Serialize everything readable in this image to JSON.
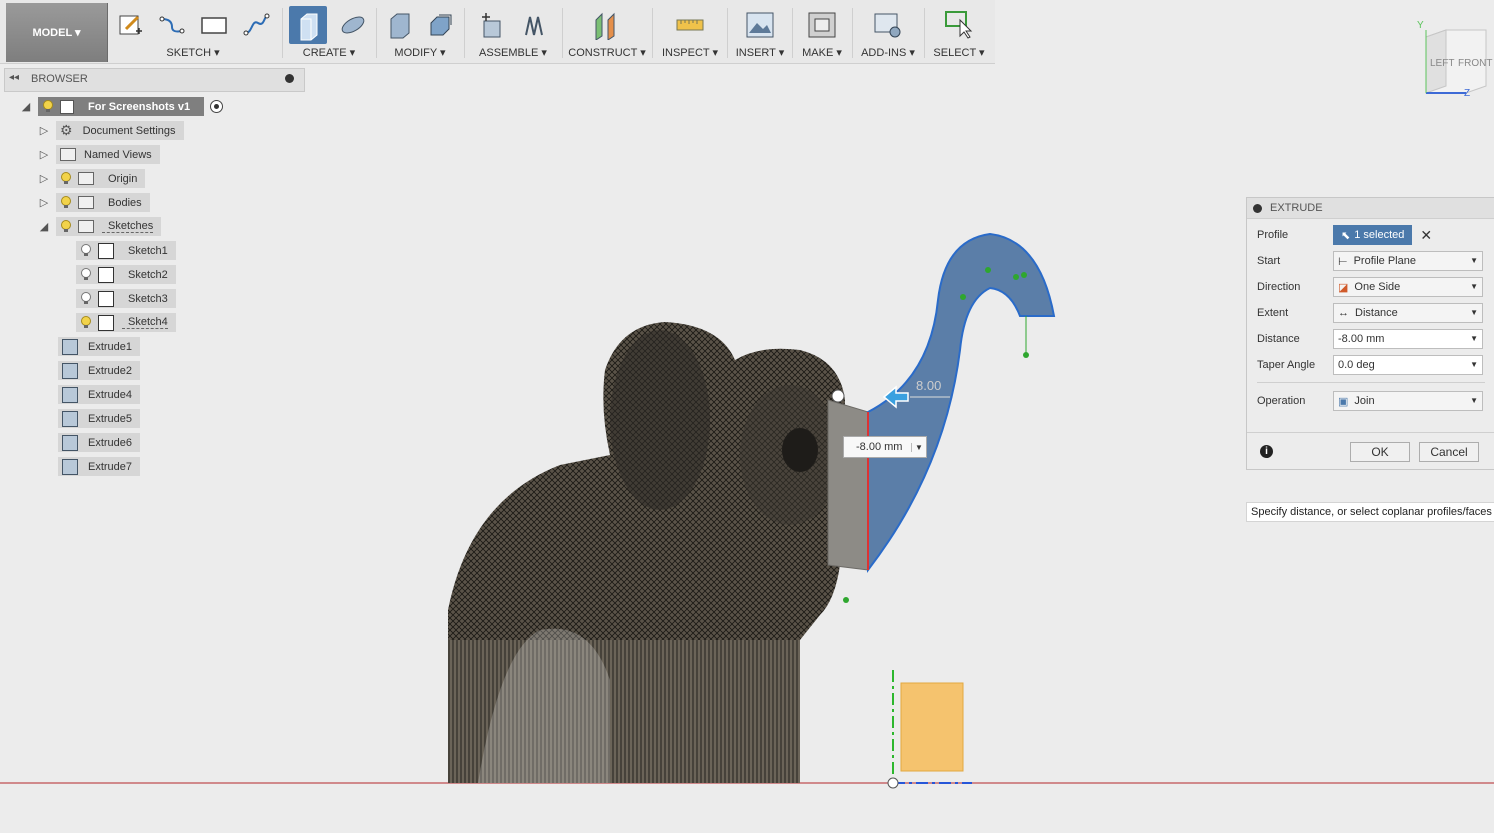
{
  "toolbar": {
    "model": "MODEL ▾",
    "groups": [
      {
        "label": "SKETCH ▾"
      },
      {
        "label": "CREATE ▾"
      },
      {
        "label": "MODIFY ▾"
      },
      {
        "label": "ASSEMBLE ▾"
      },
      {
        "label": "CONSTRUCT ▾"
      },
      {
        "label": "INSPECT ▾"
      },
      {
        "label": "INSERT ▾"
      },
      {
        "label": "MAKE ▾"
      },
      {
        "label": "ADD-INS ▾"
      },
      {
        "label": "SELECT ▾"
      }
    ]
  },
  "browser": {
    "title": "BROWSER",
    "root": "For Screenshots v1",
    "items": [
      "Document Settings",
      "Named Views",
      "Origin",
      "Bodies",
      "Sketches"
    ],
    "sketches": [
      "Sketch1",
      "Sketch2",
      "Sketch3",
      "Sketch4"
    ],
    "features": [
      "Extrude1",
      "Extrude2",
      "Extrude4",
      "Extrude5",
      "Extrude6",
      "Extrude7"
    ]
  },
  "viewcube": {
    "left": "LEFT",
    "front": "FRONT",
    "y": "Y",
    "z": "Z"
  },
  "extrude": {
    "title": "EXTRUDE",
    "profile_label": "Profile",
    "profile_value": "1 selected",
    "start_label": "Start",
    "start_value": "Profile Plane",
    "direction_label": "Direction",
    "direction_value": "One Side",
    "extent_label": "Extent",
    "extent_value": "Distance",
    "distance_label": "Distance",
    "distance_value": "-8.00 mm",
    "taper_label": "Taper Angle",
    "taper_value": "0.0 deg",
    "operation_label": "Operation",
    "operation_value": "Join",
    "ok": "OK",
    "cancel": "Cancel"
  },
  "hint": "Specify distance, or select coplanar profiles/faces t",
  "viewport": {
    "dim_input": "-8.00 mm",
    "dim_label": "8.00"
  }
}
